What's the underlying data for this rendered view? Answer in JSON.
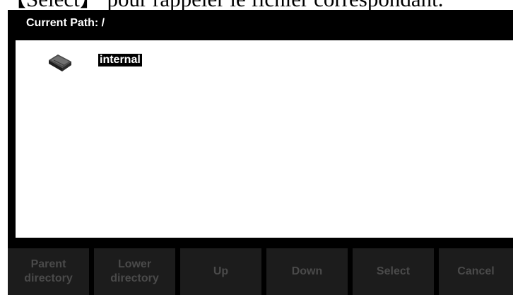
{
  "document_text": "【Select】 pour rappeler le fichier correspondant.",
  "header": {
    "path_label": "Current Path: /"
  },
  "file_list": {
    "items": [
      {
        "name": "internal",
        "icon": "storage-drive-icon"
      }
    ]
  },
  "softkeys": [
    {
      "line1": "Parent",
      "line2": "directory"
    },
    {
      "line1": "Lower",
      "line2": "directory"
    },
    {
      "line1": "Up",
      "line2": ""
    },
    {
      "line1": "Down",
      "line2": ""
    },
    {
      "line1": "Select",
      "line2": ""
    },
    {
      "line1": "Cancel",
      "line2": ""
    }
  ],
  "colors": {
    "screen_bg": "#000000",
    "panel_bg": "#ffffff",
    "softkey_bg": "#1c1c1c",
    "softkey_text_disabled": "#4a4a4a",
    "selection_bg": "#000000",
    "selection_text": "#ffffff"
  }
}
